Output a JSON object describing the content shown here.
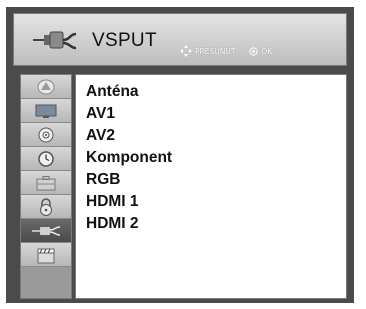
{
  "header": {
    "title": "VSPUT",
    "hint_move": "PRESUNÚŤ",
    "hint_ok": "OK"
  },
  "sidebar": {
    "items": [
      {
        "icon": "picture-icon"
      },
      {
        "icon": "tv-screen-icon"
      },
      {
        "icon": "audio-disc-icon"
      },
      {
        "icon": "clock-icon"
      },
      {
        "icon": "options-briefcase-icon"
      },
      {
        "icon": "lock-icon"
      },
      {
        "icon": "input-cable-icon"
      },
      {
        "icon": "clapper-icon"
      }
    ],
    "active_index": 6
  },
  "inputs": {
    "items": [
      {
        "label": "Anténa"
      },
      {
        "label": "AV1"
      },
      {
        "label": "AV2"
      },
      {
        "label": "Komponent"
      },
      {
        "label": "RGB"
      },
      {
        "label": "HDMI 1"
      },
      {
        "label": "HDMI 2"
      }
    ]
  }
}
